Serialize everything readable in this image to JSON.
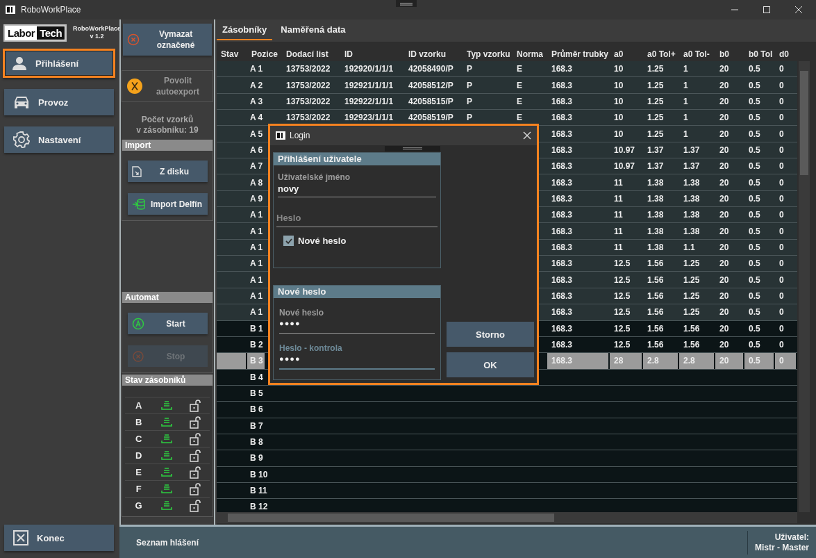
{
  "window": {
    "title": "RoboWorkPlace"
  },
  "logo": {
    "left": "Labor",
    "right": "Tech",
    "app_name": "RoboWorkPlace",
    "version": "v 1.2"
  },
  "nav": [
    {
      "label": "Přihlášení",
      "selected": true
    },
    {
      "label": "Provoz",
      "selected": false
    },
    {
      "label": "Nastavení",
      "selected": false
    }
  ],
  "exit_button": {
    "label": "Konec"
  },
  "actions": {
    "clear": {
      "label": "Vymazat označené"
    },
    "autoexport": {
      "label": "Povolit autoexport",
      "disabled": true
    },
    "count_label": "Počet vzorků\nv zásobníku:",
    "count": "19"
  },
  "import": {
    "title": "Import",
    "buttons": [
      {
        "label": "Z disku"
      },
      {
        "label": "Import Delfín"
      }
    ]
  },
  "automat": {
    "title": "Automat",
    "buttons": [
      {
        "label": "Start",
        "disabled": false
      },
      {
        "label": "Stop",
        "disabled": true
      }
    ]
  },
  "trays": {
    "title": "Stav zásobníků",
    "items": [
      {
        "label": "A",
        "locked": false
      },
      {
        "label": "B",
        "locked": false
      },
      {
        "label": "C",
        "locked": false
      },
      {
        "label": "D",
        "locked": false
      },
      {
        "label": "E",
        "locked": false
      },
      {
        "label": "F",
        "locked": false
      },
      {
        "label": "G",
        "locked": false
      }
    ]
  },
  "tabs": [
    {
      "label": "Zásobníky",
      "selected": true
    },
    {
      "label": "Naměřená data",
      "selected": false
    }
  ],
  "table": {
    "columns": [
      "Stav",
      "Pozice",
      "Dodací list",
      "ID",
      "ID vzorku",
      "Typ vzorku",
      "Norma",
      "Průměr trubky",
      "a0",
      "a0 Tol+",
      "a0 Tol-",
      "b0",
      "b0 Tol",
      "d0"
    ],
    "rows": [
      {
        "shaded": true,
        "selected": false,
        "cells": [
          null,
          "A 1",
          "13753/2022",
          "192920/1/1/1",
          "42058490/P",
          "P",
          "E",
          "168.3",
          "10",
          "1.25",
          "1",
          "20",
          "0.5",
          "0"
        ]
      },
      {
        "shaded": true,
        "selected": false,
        "cells": [
          null,
          "A 2",
          "13753/2022",
          "192921/1/1/1",
          "42058512/P",
          "P",
          "E",
          "168.3",
          "10",
          "1.25",
          "1",
          "20",
          "0.5",
          "0"
        ]
      },
      {
        "shaded": true,
        "selected": false,
        "cells": [
          null,
          "A 3",
          "13753/2022",
          "192922/1/1/1",
          "42058515/P",
          "P",
          "E",
          "168.3",
          "10",
          "1.25",
          "1",
          "20",
          "0.5",
          "0"
        ]
      },
      {
        "shaded": true,
        "selected": false,
        "cells": [
          null,
          "A 4",
          "13753/2022",
          "192923/1/1/1",
          "42058519/P",
          "P",
          "E",
          "168.3",
          "10",
          "1.25",
          "1",
          "20",
          "0.5",
          "0"
        ]
      },
      {
        "shaded": true,
        "selected": false,
        "cells": [
          null,
          "A 5",
          null,
          null,
          null,
          null,
          null,
          "168.3",
          "10",
          "1.25",
          "1",
          "20",
          "0.5",
          "0"
        ]
      },
      {
        "shaded": true,
        "selected": false,
        "cells": [
          null,
          "A 6",
          null,
          null,
          null,
          null,
          null,
          "168.3",
          "10.97",
          "1.37",
          "1.37",
          "20",
          "0.5",
          "0"
        ]
      },
      {
        "shaded": true,
        "selected": false,
        "cells": [
          null,
          "A 7",
          null,
          null,
          null,
          null,
          null,
          "168.3",
          "10.97",
          "1.37",
          "1.37",
          "20",
          "0.5",
          "0"
        ]
      },
      {
        "shaded": true,
        "selected": false,
        "cells": [
          null,
          "A 8",
          null,
          null,
          null,
          null,
          null,
          "168.3",
          "11",
          "1.38",
          "1.38",
          "20",
          "0.5",
          "0"
        ]
      },
      {
        "shaded": true,
        "selected": false,
        "cells": [
          null,
          "A 9",
          null,
          null,
          null,
          null,
          null,
          "168.3",
          "11",
          "1.38",
          "1.38",
          "20",
          "0.5",
          "0"
        ]
      },
      {
        "shaded": true,
        "selected": false,
        "cells": [
          null,
          "A 1",
          null,
          null,
          null,
          null,
          null,
          "168.3",
          "11",
          "1.38",
          "1.38",
          "20",
          "0.5",
          "0"
        ]
      },
      {
        "shaded": true,
        "selected": false,
        "cells": [
          null,
          "A 1",
          null,
          null,
          null,
          null,
          null,
          "168.3",
          "11",
          "1.38",
          "1.38",
          "20",
          "0.5",
          "0"
        ]
      },
      {
        "shaded": true,
        "selected": false,
        "cells": [
          null,
          "A 1",
          null,
          null,
          null,
          null,
          null,
          "168.3",
          "11",
          "1.38",
          "1.1",
          "20",
          "0.5",
          "0"
        ]
      },
      {
        "shaded": true,
        "selected": false,
        "cells": [
          null,
          "A 1",
          null,
          null,
          null,
          null,
          null,
          "168.3",
          "12.5",
          "1.56",
          "1.25",
          "20",
          "0.5",
          "0"
        ]
      },
      {
        "shaded": true,
        "selected": false,
        "cells": [
          null,
          "A 1",
          null,
          null,
          null,
          null,
          null,
          "168.3",
          "12.5",
          "1.56",
          "1.25",
          "20",
          "0.5",
          "0"
        ]
      },
      {
        "shaded": true,
        "selected": false,
        "cells": [
          null,
          "A 1",
          null,
          null,
          null,
          null,
          null,
          "168.3",
          "12.5",
          "1.56",
          "1.25",
          "20",
          "0.5",
          "0"
        ]
      },
      {
        "shaded": true,
        "selected": false,
        "cells": [
          null,
          "A 1",
          null,
          null,
          null,
          null,
          null,
          "168.3",
          "12.5",
          "1.56",
          "1.25",
          "20",
          "0.5",
          "0"
        ]
      },
      {
        "shaded": false,
        "selected": false,
        "cells": [
          null,
          "B 1",
          null,
          null,
          null,
          null,
          null,
          "168.3",
          "12.5",
          "1.56",
          "1.56",
          "20",
          "0.5",
          "0"
        ]
      },
      {
        "shaded": false,
        "selected": false,
        "cells": [
          null,
          "B 2",
          null,
          null,
          null,
          null,
          null,
          "168.3",
          "12.5",
          "1.56",
          "1.56",
          "20",
          "0.5",
          "0"
        ]
      },
      {
        "shaded": false,
        "selected": true,
        "cells": [
          null,
          "B 3",
          null,
          null,
          null,
          null,
          null,
          "168.3",
          "28",
          "2.8",
          "2.8",
          "20",
          "0.5",
          "0"
        ]
      },
      {
        "shaded": false,
        "selected": false,
        "cells": [
          null,
          "B 4"
        ]
      },
      {
        "shaded": false,
        "selected": false,
        "cells": [
          null,
          "B 5"
        ]
      },
      {
        "shaded": false,
        "selected": false,
        "cells": [
          null,
          "B 6"
        ]
      },
      {
        "shaded": false,
        "selected": false,
        "cells": [
          null,
          "B 7"
        ]
      },
      {
        "shaded": false,
        "selected": false,
        "cells": [
          null,
          "B 8"
        ]
      },
      {
        "shaded": false,
        "selected": false,
        "cells": [
          null,
          "B 9"
        ]
      },
      {
        "shaded": false,
        "selected": false,
        "cells": [
          null,
          "B 10"
        ]
      },
      {
        "shaded": false,
        "selected": false,
        "cells": [
          null,
          "B 11"
        ]
      },
      {
        "shaded": false,
        "selected": false,
        "cells": [
          null,
          "B 12"
        ]
      }
    ]
  },
  "bottom_bar": {
    "messages_button": "Seznam hlášení",
    "user_label": "Uživatel:",
    "user": "Mistr  -  Master"
  },
  "dialog": {
    "title": "Login",
    "login_group": {
      "title": "Přihlášení uživatele",
      "username": {
        "label": "Uživatelské jméno",
        "value": "novy"
      },
      "password": {
        "placeholder": "Heslo"
      },
      "new_password_checkbox": {
        "label": "Nové heslo",
        "checked": true
      }
    },
    "new_password_group": {
      "title": "Nové heslo",
      "fields": [
        {
          "label": "Nové heslo",
          "value": "●●●●",
          "focused": false
        },
        {
          "label": "Heslo - kontrola",
          "value": "●●●●",
          "focused": true
        }
      ]
    },
    "buttons": [
      "Storno",
      "OK"
    ]
  }
}
